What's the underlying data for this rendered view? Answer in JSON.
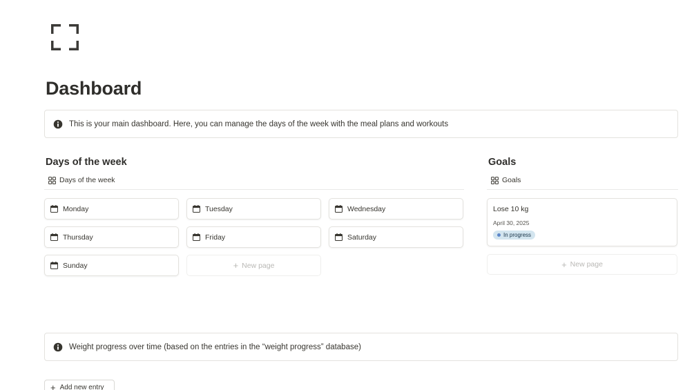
{
  "page": {
    "icon": "frame-corners-icon",
    "title": "Dashboard"
  },
  "callouts": {
    "intro": {
      "icon": "info-icon",
      "text": "This is your main dashboard. Here, you can manage the days of the week with the meal plans and workouts"
    },
    "weight": {
      "icon": "info-icon",
      "text": "Weight progress over time (based on the entries in the “weight progress” database)"
    }
  },
  "days": {
    "heading": "Days of the week",
    "view_label": "Days of the week",
    "items": [
      "Monday",
      "Tuesday",
      "Wednesday",
      "Thursday",
      "Friday",
      "Saturday",
      "Sunday"
    ],
    "new_page_label": "New page"
  },
  "goals": {
    "heading": "Goals",
    "view_label": "Goals",
    "items": [
      {
        "title": "Lose 10 kg",
        "date": "April 30, 2025",
        "status": "In progress"
      }
    ],
    "new_page_label": "New page"
  },
  "add_entry_label": "Add new entry",
  "colors": {
    "text": "#37352f",
    "border": "#e3e2de",
    "status_bg": "#d3e5ef",
    "status_dot": "#5e87c9"
  }
}
